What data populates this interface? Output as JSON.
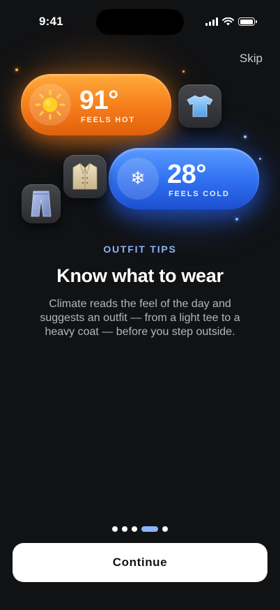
{
  "status_bar": {
    "time": "9:41"
  },
  "top": {
    "skip_label": "Skip"
  },
  "hero": {
    "hot": {
      "temp": "91°",
      "caption": "FEELS HOT",
      "icon": "sun-icon"
    },
    "cold": {
      "temp": "28°",
      "caption": "FEELS COLD",
      "icon": "snowflake-icon"
    },
    "tiles": [
      "t-shirt-icon",
      "coat-icon",
      "pants-icon"
    ]
  },
  "content": {
    "eyebrow": "OUTFIT TIPS",
    "title": "Know what to wear",
    "body": "Climate reads the feel of the day and suggests an outfit — from a light tee to a heavy coat — before you step outside."
  },
  "pager": {
    "count": 5,
    "active_index": 3
  },
  "cta": {
    "continue_label": "Continue"
  },
  "colors": {
    "background": "#111214",
    "accent": "#8ab4f8",
    "hot": "#f57c1a",
    "cold": "#2f6ff0"
  }
}
